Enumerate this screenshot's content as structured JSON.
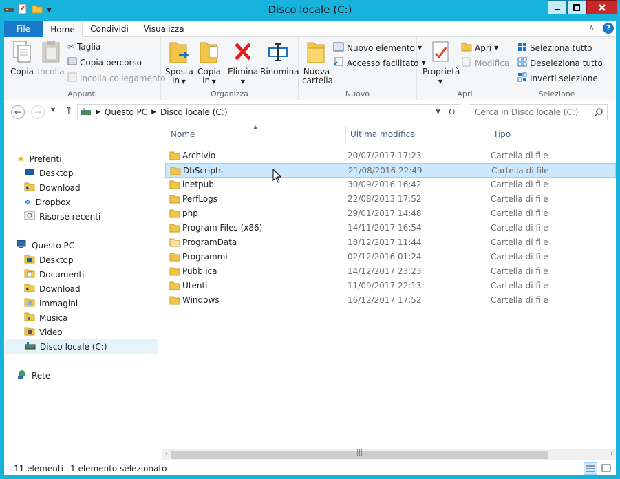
{
  "window": {
    "title": "Disco locale (C:)"
  },
  "tabs": {
    "file": "File",
    "home": "Home",
    "share": "Condividi",
    "view": "Visualizza"
  },
  "ribbon": {
    "clipboard": {
      "label": "Appunti",
      "copy": "Copia",
      "paste": "Incolla",
      "cut": "Taglia",
      "copy_path": "Copia percorso",
      "paste_shortcut": "Incolla collegamento"
    },
    "organize": {
      "label": "Organizza",
      "move_to_l1": "Sposta",
      "move_to_l2": "in",
      "copy_to_l1": "Copia",
      "copy_to_l2": "in",
      "delete": "Elimina",
      "rename": "Rinomina"
    },
    "new": {
      "label": "Nuovo",
      "new_folder_l1": "Nuova",
      "new_folder_l2": "cartella",
      "new_item": "Nuovo elemento",
      "easy_access": "Accesso facilitato"
    },
    "open": {
      "label": "Apri",
      "properties": "Proprietà",
      "open": "Apri",
      "edit": "Modifica"
    },
    "select": {
      "label": "Selezione",
      "select_all": "Seleziona tutto",
      "select_none": "Deseleziona tutto",
      "invert": "Inverti selezione"
    }
  },
  "address": {
    "crumb1": "Questo PC",
    "crumb2": "Disco locale (C:)",
    "search_placeholder": "Cerca in Disco locale (C:)"
  },
  "nav": {
    "favorites": "Preferiti",
    "fav_items": [
      "Desktop",
      "Download",
      "Dropbox",
      "Risorse recenti"
    ],
    "pc": "Questo PC",
    "pc_items": [
      "Desktop",
      "Documenti",
      "Download",
      "Immagini",
      "Musica",
      "Video",
      "Disco locale (C:)"
    ],
    "network": "Rete"
  },
  "columns": {
    "name": "Nome",
    "modified": "Ultima modifica",
    "type": "Tipo"
  },
  "files": [
    {
      "name": "Archivio",
      "date": "20/07/2017 17:23",
      "type": "Cartella di file"
    },
    {
      "name": "DbScripts",
      "date": "21/08/2016 22:49",
      "type": "Cartella di file"
    },
    {
      "name": "inetpub",
      "date": "30/09/2016 16:42",
      "type": "Cartella di file"
    },
    {
      "name": "PerfLogs",
      "date": "22/08/2013 17:52",
      "type": "Cartella di file"
    },
    {
      "name": "php",
      "date": "29/01/2017 14:48",
      "type": "Cartella di file"
    },
    {
      "name": "Program Files (x86)",
      "date": "14/11/2017 16:54",
      "type": "Cartella di file"
    },
    {
      "name": "ProgramData",
      "date": "18/12/2017 11:44",
      "type": "Cartella di file"
    },
    {
      "name": "Programmi",
      "date": "02/12/2016 01:24",
      "type": "Cartella di file"
    },
    {
      "name": "Pubblica",
      "date": "14/12/2017 23:23",
      "type": "Cartella di file"
    },
    {
      "name": "Utenti",
      "date": "11/09/2017 22:13",
      "type": "Cartella di file"
    },
    {
      "name": "Windows",
      "date": "16/12/2017 17:52",
      "type": "Cartella di file"
    }
  ],
  "status": {
    "count": "11 elementi",
    "selected": "1 elemento selezionato"
  },
  "colors": {
    "title_bar": "#18b3dd",
    "file_tab": "#1979ca",
    "selection": "#cce8ff"
  }
}
